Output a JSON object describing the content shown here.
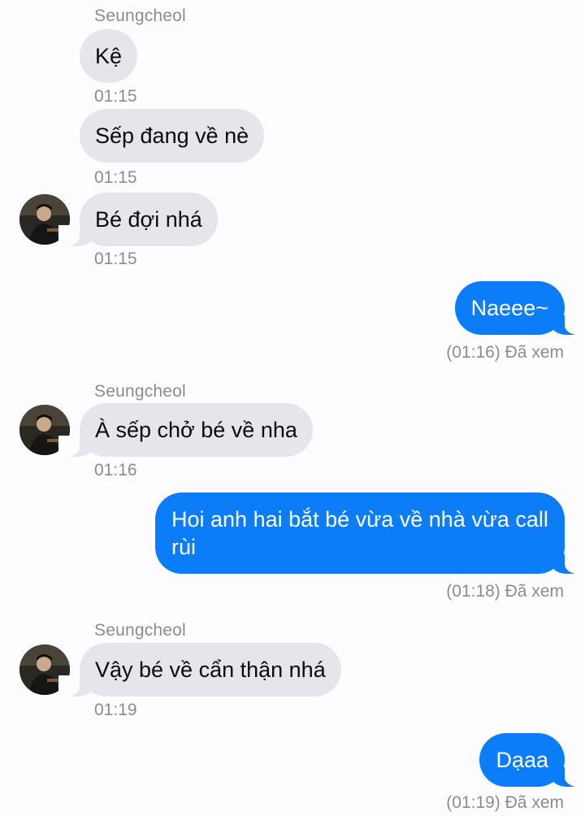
{
  "messages": {
    "group1": {
      "sender": "Seungcheol",
      "m1": {
        "text": "Kệ",
        "time": "01:15"
      },
      "m2": {
        "text": "Sếp đang về nè",
        "time": "01:15"
      },
      "m3": {
        "text": "Bé đợi nhá",
        "time": "01:15"
      }
    },
    "out1": {
      "text": "Naeee~",
      "status": "(01:16) Đã xem"
    },
    "group2": {
      "sender": "Seungcheol",
      "m1": {
        "text": "À sếp chở bé về nha",
        "time": "01:16"
      }
    },
    "out2": {
      "text": "Hoi anh hai bắt bé vừa về nhà vừa call rùi",
      "status": "(01:18) Đã xem"
    },
    "group3": {
      "sender": "Seungcheol",
      "m1": {
        "text": "Vậy bé về cẩn thận nhá",
        "time": "01:19"
      }
    },
    "out3": {
      "text": "Dạaa",
      "status": "(01:19) Đã xem"
    }
  },
  "colors": {
    "sent_bubble": "#0b7df8",
    "received_bubble": "#e6e5eb",
    "meta_text": "#8c8c90"
  },
  "icons": {
    "avatar": "contact-avatar-photo"
  }
}
